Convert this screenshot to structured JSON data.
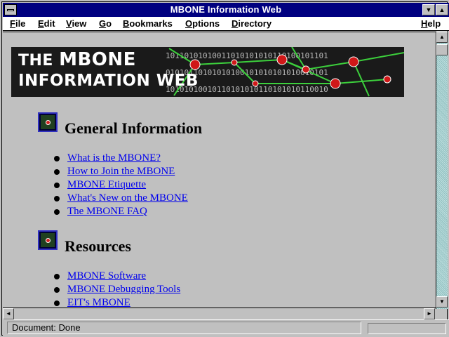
{
  "window": {
    "title": "MBONE Information Web"
  },
  "menu": [
    {
      "label_first": "F",
      "label_rest": "ile"
    },
    {
      "label_first": "E",
      "label_rest": "dit"
    },
    {
      "label_first": "V",
      "label_rest": "iew"
    },
    {
      "label_first": "G",
      "label_rest": "o"
    },
    {
      "label_first": "B",
      "label_rest": "ookmarks"
    },
    {
      "label_first": "O",
      "label_rest": "ptions"
    },
    {
      "label_first": "D",
      "label_rest": "irectory"
    },
    {
      "label_first": "H",
      "label_rest": "elp"
    }
  ],
  "banner": {
    "line1_prefix": "THE ",
    "line1_main": "MBONE",
    "line2": "INFORMATION WEB",
    "binary_rows": [
      "10110101010011010101010110100101101",
      "01010110101010100101010101010010101",
      "10101010010110101010110101010110010"
    ]
  },
  "sections": [
    {
      "heading": "General Information",
      "links": [
        "What is the MBONE?",
        "How to Join the MBONE",
        "MBONE Etiquette",
        "What's New on the MBONE",
        "The MBONE FAQ"
      ]
    },
    {
      "heading": "Resources",
      "links": [
        "MBONE Software",
        "MBONE Debugging Tools",
        "EIT's MBONE"
      ]
    }
  ],
  "status": {
    "text": "Document: Done"
  },
  "colors": {
    "titlebar": "#000080",
    "link": "#0000ee",
    "background": "#c0c0c0"
  }
}
